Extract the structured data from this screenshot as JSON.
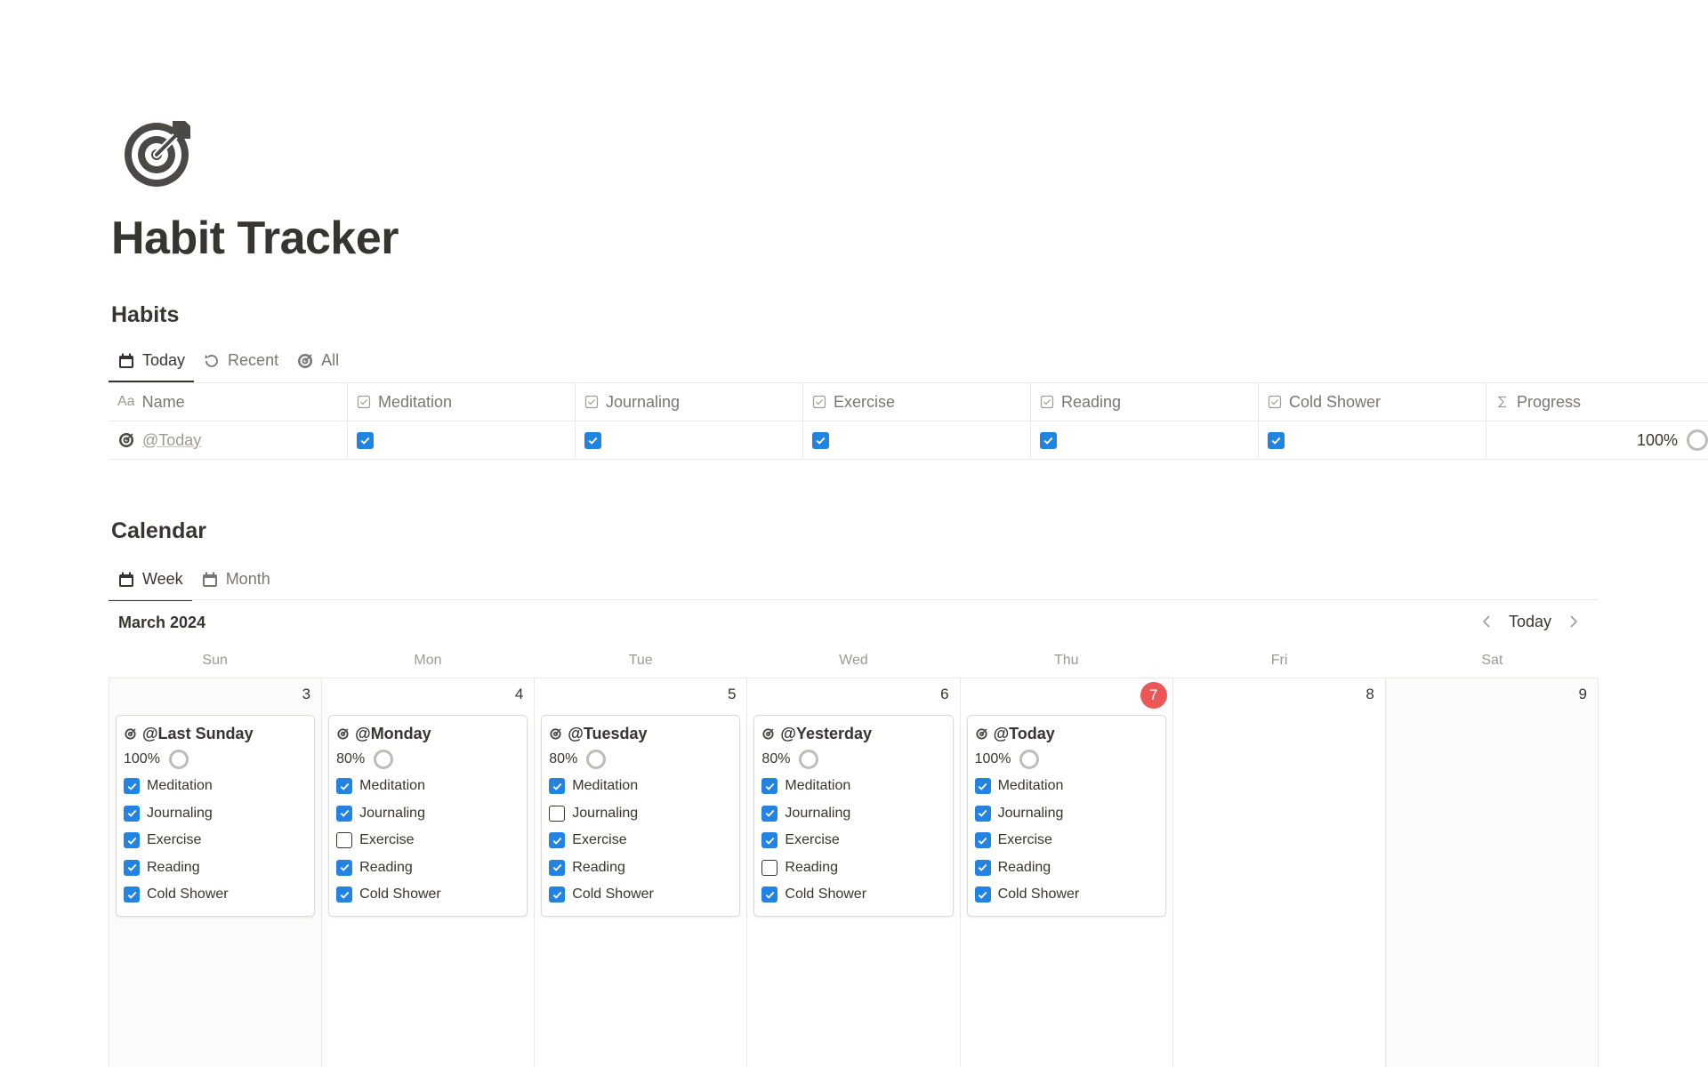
{
  "page": {
    "icon": "target-icon",
    "title": "Habit Tracker"
  },
  "habits": {
    "title": "Habits",
    "tabs": [
      {
        "label": "Today",
        "icon": "calendar-icon",
        "active": true
      },
      {
        "label": "Recent",
        "icon": "history-icon",
        "active": false
      },
      {
        "label": "All",
        "icon": "target-icon",
        "active": false
      }
    ],
    "columns": [
      {
        "label": "Name",
        "icon": "Aa"
      },
      {
        "label": "Meditation",
        "icon": "checkbox-icon"
      },
      {
        "label": "Journaling",
        "icon": "checkbox-icon"
      },
      {
        "label": "Exercise",
        "icon": "checkbox-icon"
      },
      {
        "label": "Reading",
        "icon": "checkbox-icon"
      },
      {
        "label": "Cold Shower",
        "icon": "checkbox-icon"
      },
      {
        "label": "Progress",
        "icon": "sigma-icon"
      }
    ],
    "rows": [
      {
        "name": "@Today",
        "meditation": true,
        "journaling": true,
        "exercise": true,
        "reading": true,
        "cold_shower": true,
        "progress": "100%"
      }
    ]
  },
  "calendar": {
    "title": "Calendar",
    "tabs": [
      {
        "label": "Week",
        "icon": "calendar-icon",
        "active": true
      },
      {
        "label": "Month",
        "icon": "calendar-icon",
        "active": false
      }
    ],
    "month_label": "March 2024",
    "today_button": "Today",
    "weekdays": [
      "Sun",
      "Mon",
      "Tue",
      "Wed",
      "Thu",
      "Fri",
      "Sat"
    ],
    "days": [
      {
        "num": "3",
        "weekend": true,
        "today": false,
        "entry": {
          "title": "@Last Sunday",
          "progress": "100%",
          "habits": [
            [
              "Meditation",
              true
            ],
            [
              "Journaling",
              true
            ],
            [
              "Exercise",
              true
            ],
            [
              "Reading",
              true
            ],
            [
              "Cold Shower",
              true
            ]
          ]
        }
      },
      {
        "num": "4",
        "weekend": false,
        "today": false,
        "entry": {
          "title": "@Monday",
          "progress": "80%",
          "habits": [
            [
              "Meditation",
              true
            ],
            [
              "Journaling",
              true
            ],
            [
              "Exercise",
              false
            ],
            [
              "Reading",
              true
            ],
            [
              "Cold Shower",
              true
            ]
          ]
        }
      },
      {
        "num": "5",
        "weekend": false,
        "today": false,
        "entry": {
          "title": "@Tuesday",
          "progress": "80%",
          "habits": [
            [
              "Meditation",
              true
            ],
            [
              "Journaling",
              false
            ],
            [
              "Exercise",
              true
            ],
            [
              "Reading",
              true
            ],
            [
              "Cold Shower",
              true
            ]
          ]
        }
      },
      {
        "num": "6",
        "weekend": false,
        "today": false,
        "entry": {
          "title": "@Yesterday",
          "progress": "80%",
          "habits": [
            [
              "Meditation",
              true
            ],
            [
              "Journaling",
              true
            ],
            [
              "Exercise",
              true
            ],
            [
              "Reading",
              false
            ],
            [
              "Cold Shower",
              true
            ]
          ]
        }
      },
      {
        "num": "7",
        "weekend": false,
        "today": true,
        "entry": {
          "title": "@Today",
          "progress": "100%",
          "habits": [
            [
              "Meditation",
              true
            ],
            [
              "Journaling",
              true
            ],
            [
              "Exercise",
              true
            ],
            [
              "Reading",
              true
            ],
            [
              "Cold Shower",
              true
            ]
          ]
        }
      },
      {
        "num": "8",
        "weekend": false,
        "today": false,
        "entry": null
      },
      {
        "num": "9",
        "weekend": true,
        "today": false,
        "entry": null
      }
    ]
  },
  "colors": {
    "text": "#37352f",
    "muted": "#787774",
    "checkbox": "#2383e2",
    "today_badge": "#eb5757",
    "weekend_bg": "#fbfbfa"
  }
}
